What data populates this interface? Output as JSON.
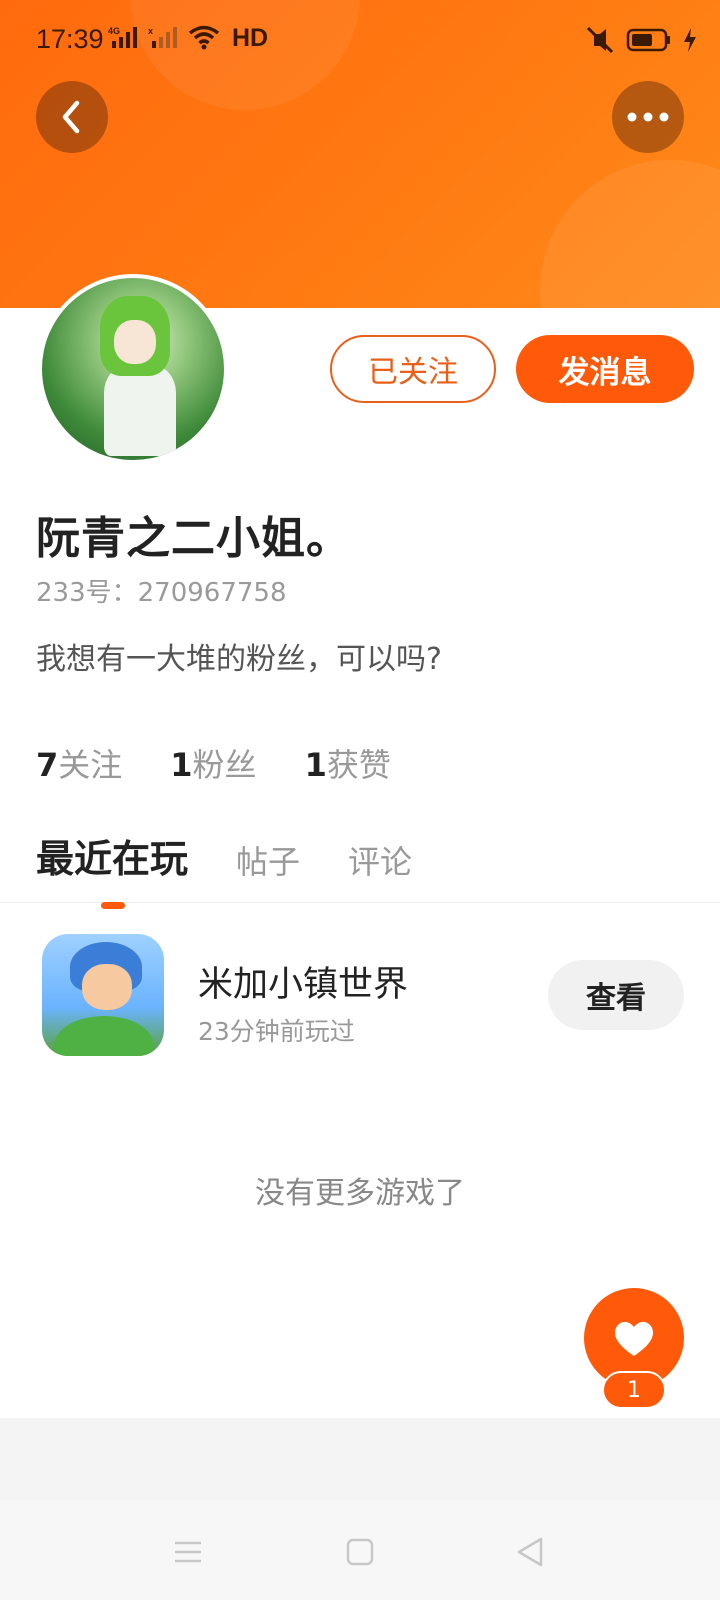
{
  "status_bar": {
    "time": "17:39",
    "network_label": "HD",
    "icons": [
      "4g-signal-icon",
      "no-sim-signal-icon",
      "wifi-icon",
      "mute-vibrate-icon",
      "battery-icon",
      "charging-icon"
    ]
  },
  "header": {
    "back_icon": "back-arrow-icon",
    "more_icon": "more-icon"
  },
  "profile": {
    "username": "阮青之二小姐。",
    "id_text": "233号：270967758",
    "bio": "我想有一大堆的粉丝，可以吗?",
    "followed_label": "已关注",
    "message_label": "发消息",
    "stats": [
      {
        "count": "7",
        "label": "关注"
      },
      {
        "count": "1",
        "label": "粉丝"
      },
      {
        "count": "1",
        "label": "获赞"
      }
    ]
  },
  "tabs": [
    {
      "label": "最近在玩",
      "active": true
    },
    {
      "label": "帖子",
      "active": false
    },
    {
      "label": "评论",
      "active": false
    }
  ],
  "games": [
    {
      "name": "米加小镇世界",
      "time": "23分钟前玩过",
      "action": "查看"
    }
  ],
  "footer_text": "没有更多游戏了",
  "like": {
    "count": "1",
    "icon": "heart-icon"
  },
  "nav": {
    "icons": [
      "menu-icon",
      "home-square-icon",
      "back-triangle-icon"
    ]
  },
  "colors": {
    "accent": "#ff5a0a",
    "header_gradient_start": "#ff6a0e",
    "header_gradient_end": "#ff8a1a"
  }
}
